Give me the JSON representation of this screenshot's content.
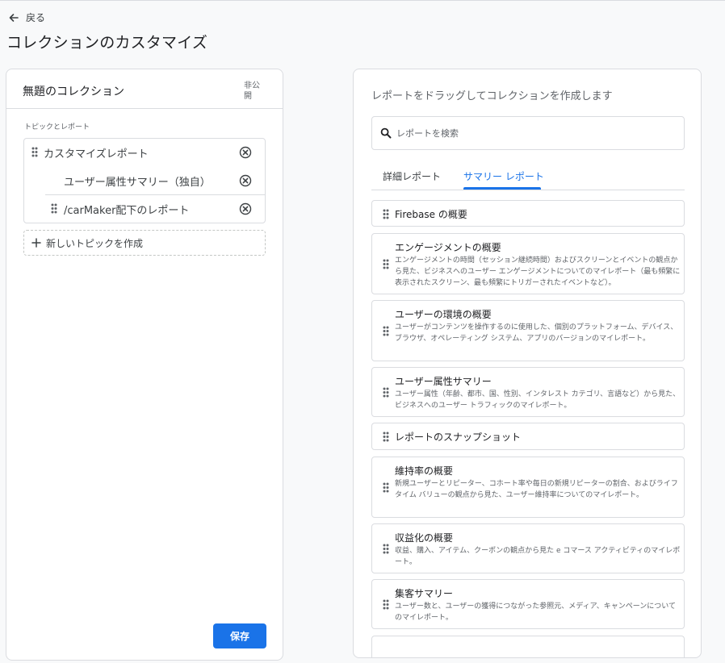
{
  "nav": {
    "back_label": "戻る"
  },
  "page": {
    "title": "コレクションのカスタマイズ"
  },
  "collection": {
    "title": "無題のコレクション",
    "visibility": "非公開",
    "section_label": "トピックとレポート",
    "topic": {
      "label": "カスタマイズレポート"
    },
    "reports": [
      {
        "label": "ユーザー属性サマリー（独自）"
      },
      {
        "label": "/carMaker配下のレポート"
      }
    ],
    "new_topic_label": "新しいトピックを作成",
    "save_label": "保存"
  },
  "library": {
    "heading": "レポートをドラッグしてコレクションを作成します",
    "search_placeholder": "レポートを検索",
    "tabs": [
      {
        "label": "詳細レポート",
        "active": false
      },
      {
        "label": "サマリー レポート",
        "active": true
      }
    ],
    "reports": [
      {
        "title": "Firebase の概要",
        "description": ""
      },
      {
        "title": "エンゲージメントの概要",
        "description": "エンゲージメントの時間（セッション継続時間）およびスクリーンとイベントの観点から見た、ビジネスへのユーザー エンゲージメントについてのマイレポート（最も頻繁に表示されたスクリーン、最も頻繁にトリガーされたイベントなど）。"
      },
      {
        "title": "ユーザーの環境の概要",
        "description": "ユーザーがコンテンツを操作するのに使用した、個別のプラットフォーム、デバイス、ブラウザ、オペレーティング システム、アプリのバージョンのマイレポート。"
      },
      {
        "title": "ユーザー属性サマリー",
        "description": "ユーザー属性（年齢、都市、国、性別、インタレスト カテゴリ、言語など）から見た、ビジネスへのユーザー トラフィックのマイレポート。"
      },
      {
        "title": "レポートのスナップショット",
        "description": ""
      },
      {
        "title": "維持率の概要",
        "description": "新規ユーザーとリピーター、コホート率や毎日の新規リピーターの割合、およびライフタイム バリューの観点から見た、ユーザー維持率についてのマイレポート。"
      },
      {
        "title": "収益化の概要",
        "description": "収益、購入、アイテム、クーポンの観点から見た e コマース アクティビティのマイレポート。"
      },
      {
        "title": "集客サマリー",
        "description": "ユーザー数と、ユーザーの獲得につながった参照元、メディア、キャンペーンについてのマイレポート。"
      }
    ]
  },
  "icons": {
    "back": "arrow-left-icon",
    "drag": "drag-handle-icon",
    "remove": "close-circle-icon",
    "add": "plus-icon",
    "search": "search-icon"
  },
  "colors": {
    "accent": "#1a73e8",
    "border": "#dadce0",
    "text": "#202124",
    "muted": "#5f6368"
  }
}
